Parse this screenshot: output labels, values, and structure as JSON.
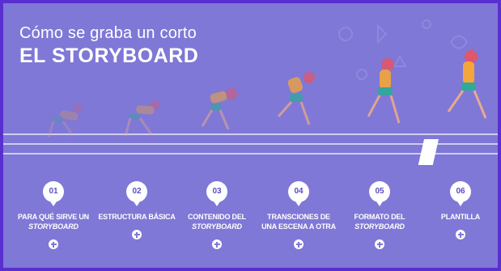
{
  "header": {
    "subtitle": "Cómo se graba un corto",
    "title": "EL STORYBOARD"
  },
  "colors": {
    "background": "#7f78d6",
    "border": "#5a2fd0",
    "badge": "#ffffff",
    "text": "#ffffff",
    "runner_shirt": "#f4a63a",
    "runner_shorts": "#2fa99a",
    "runner_hair": "#e0566b"
  },
  "steps": [
    {
      "number": "01",
      "label_line1": "PARA QUÉ SIRVE UN",
      "label_line2": "STORYBOARD",
      "icon": "plus-icon"
    },
    {
      "number": "02",
      "label_line1": "ESTRUCTURA BÁSICA",
      "label_line2": "",
      "icon": "plus-icon"
    },
    {
      "number": "03",
      "label_line1": "CONTENIDO DEL",
      "label_line2": "STORYBOARD",
      "icon": "plus-icon"
    },
    {
      "number": "04",
      "label_line1": "TRANSCIONES DE",
      "label_line2": "UNA ESCENA A OTRA",
      "icon": "plus-icon"
    },
    {
      "number": "05",
      "label_line1": "FORMATO DEL",
      "label_line2": "STORYBOARD",
      "icon": "plus-icon"
    },
    {
      "number": "06",
      "label_line1": "PLANTILLA",
      "label_line2": "",
      "icon": "plus-icon"
    }
  ]
}
